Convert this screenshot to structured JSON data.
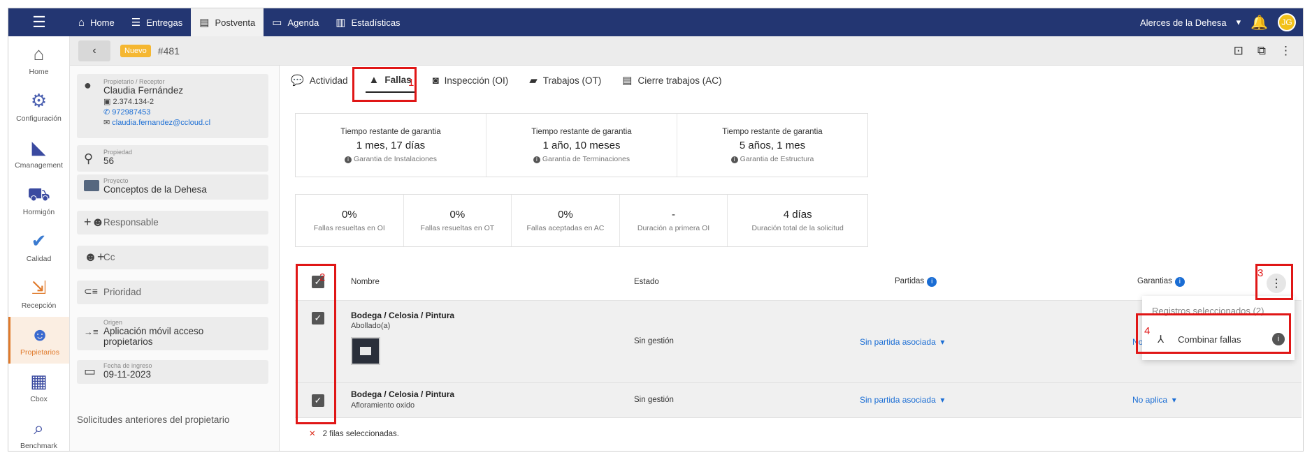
{
  "topbar": {
    "nav": [
      {
        "label": "Home",
        "icon": "home-icon"
      },
      {
        "label": "Entregas",
        "icon": "list-icon"
      },
      {
        "label": "Postventa",
        "icon": "postventa-icon"
      },
      {
        "label": "Agenda",
        "icon": "calendar-icon"
      },
      {
        "label": "Estadísticas",
        "icon": "chart-icon"
      }
    ],
    "project_selector": "Alerces de la Dehesa",
    "avatar_initials": "JG"
  },
  "rail": [
    {
      "label": "Home"
    },
    {
      "label": "Configuración"
    },
    {
      "label": "Cmanagement"
    },
    {
      "label": "Hormigón"
    },
    {
      "label": "Calidad"
    },
    {
      "label": "Recepción"
    },
    {
      "label": "Propietarios"
    },
    {
      "label": "Cbox"
    },
    {
      "label": "Benchmark"
    }
  ],
  "subbar": {
    "badge": "Nuevo",
    "ticket": "#481"
  },
  "left": {
    "owner": {
      "label": "Propietario / Receptor",
      "name": "Claudia Fernández",
      "rut": "2.374.134-2",
      "phone": "972987453",
      "email": "claudia.fernandez@ccloud.cl"
    },
    "property": {
      "label": "Propiedad",
      "value": "56"
    },
    "project": {
      "label": "Proyecto",
      "value": "Conceptos de la Dehesa"
    },
    "responsable": "Responsable",
    "cc": "Cc",
    "priority": "Prioridad",
    "origin": {
      "label": "Origen",
      "value1": "Aplicación móvil acceso",
      "value2": "propietarios"
    },
    "date": {
      "label": "Fecha de ingreso",
      "value": "09-11-2023"
    },
    "previous_title": "Solicitudes anteriores del propietario"
  },
  "tabs": [
    {
      "label": "Actividad"
    },
    {
      "label": "Fallas"
    },
    {
      "label": "Inspección (OI)"
    },
    {
      "label": "Trabajos (OT)"
    },
    {
      "label": "Cierre trabajos (AC)"
    }
  ],
  "warranty": [
    {
      "title": "Tiempo restante de garantia",
      "value": "1 mes, 17 días",
      "sub": "Garantia de Instalaciones"
    },
    {
      "title": "Tiempo restante de garantia",
      "value": "1 año, 10 meses",
      "sub": "Garantia de Terminaciones"
    },
    {
      "title": "Tiempo restante de garantia",
      "value": "5 años, 1 mes",
      "sub": "Garantia de Estructura"
    }
  ],
  "stats": [
    {
      "value": "0%",
      "sub": "Fallas resueltas en OI"
    },
    {
      "value": "0%",
      "sub": "Fallas resueltas en OT"
    },
    {
      "value": "0%",
      "sub": "Fallas aceptadas en AC"
    },
    {
      "value": "-",
      "sub": "Duración a primera OI"
    },
    {
      "value": "4 días",
      "sub": "Duración total de la solicitud"
    }
  ],
  "table": {
    "headers": {
      "name": "Nombre",
      "estado": "Estado",
      "partidas": "Partidas",
      "garantias": "Garantias"
    },
    "rows": [
      {
        "name": "Bodega / Celosia / Pintura",
        "sub": "Abollado(a)",
        "estado": "Sin gestión",
        "partida": "Sin partida asociada",
        "garantia": "No"
      },
      {
        "name": "Bodega / Celosia / Pintura",
        "sub": "Afloramiento oxido",
        "estado": "Sin gestión",
        "partida": "Sin partida asociada",
        "garantia": "No aplica"
      }
    ],
    "selected_footer": "2 filas seleccionadas."
  },
  "menu": {
    "header": "Registros seleccionados (2)",
    "item": "Combinar fallas"
  },
  "annotations": [
    "1",
    "2",
    "3",
    "4"
  ],
  "colors": {
    "topbar": "#233672",
    "accent": "#e07a2b",
    "annotation": "#e01616",
    "link": "#1a6dd4"
  }
}
